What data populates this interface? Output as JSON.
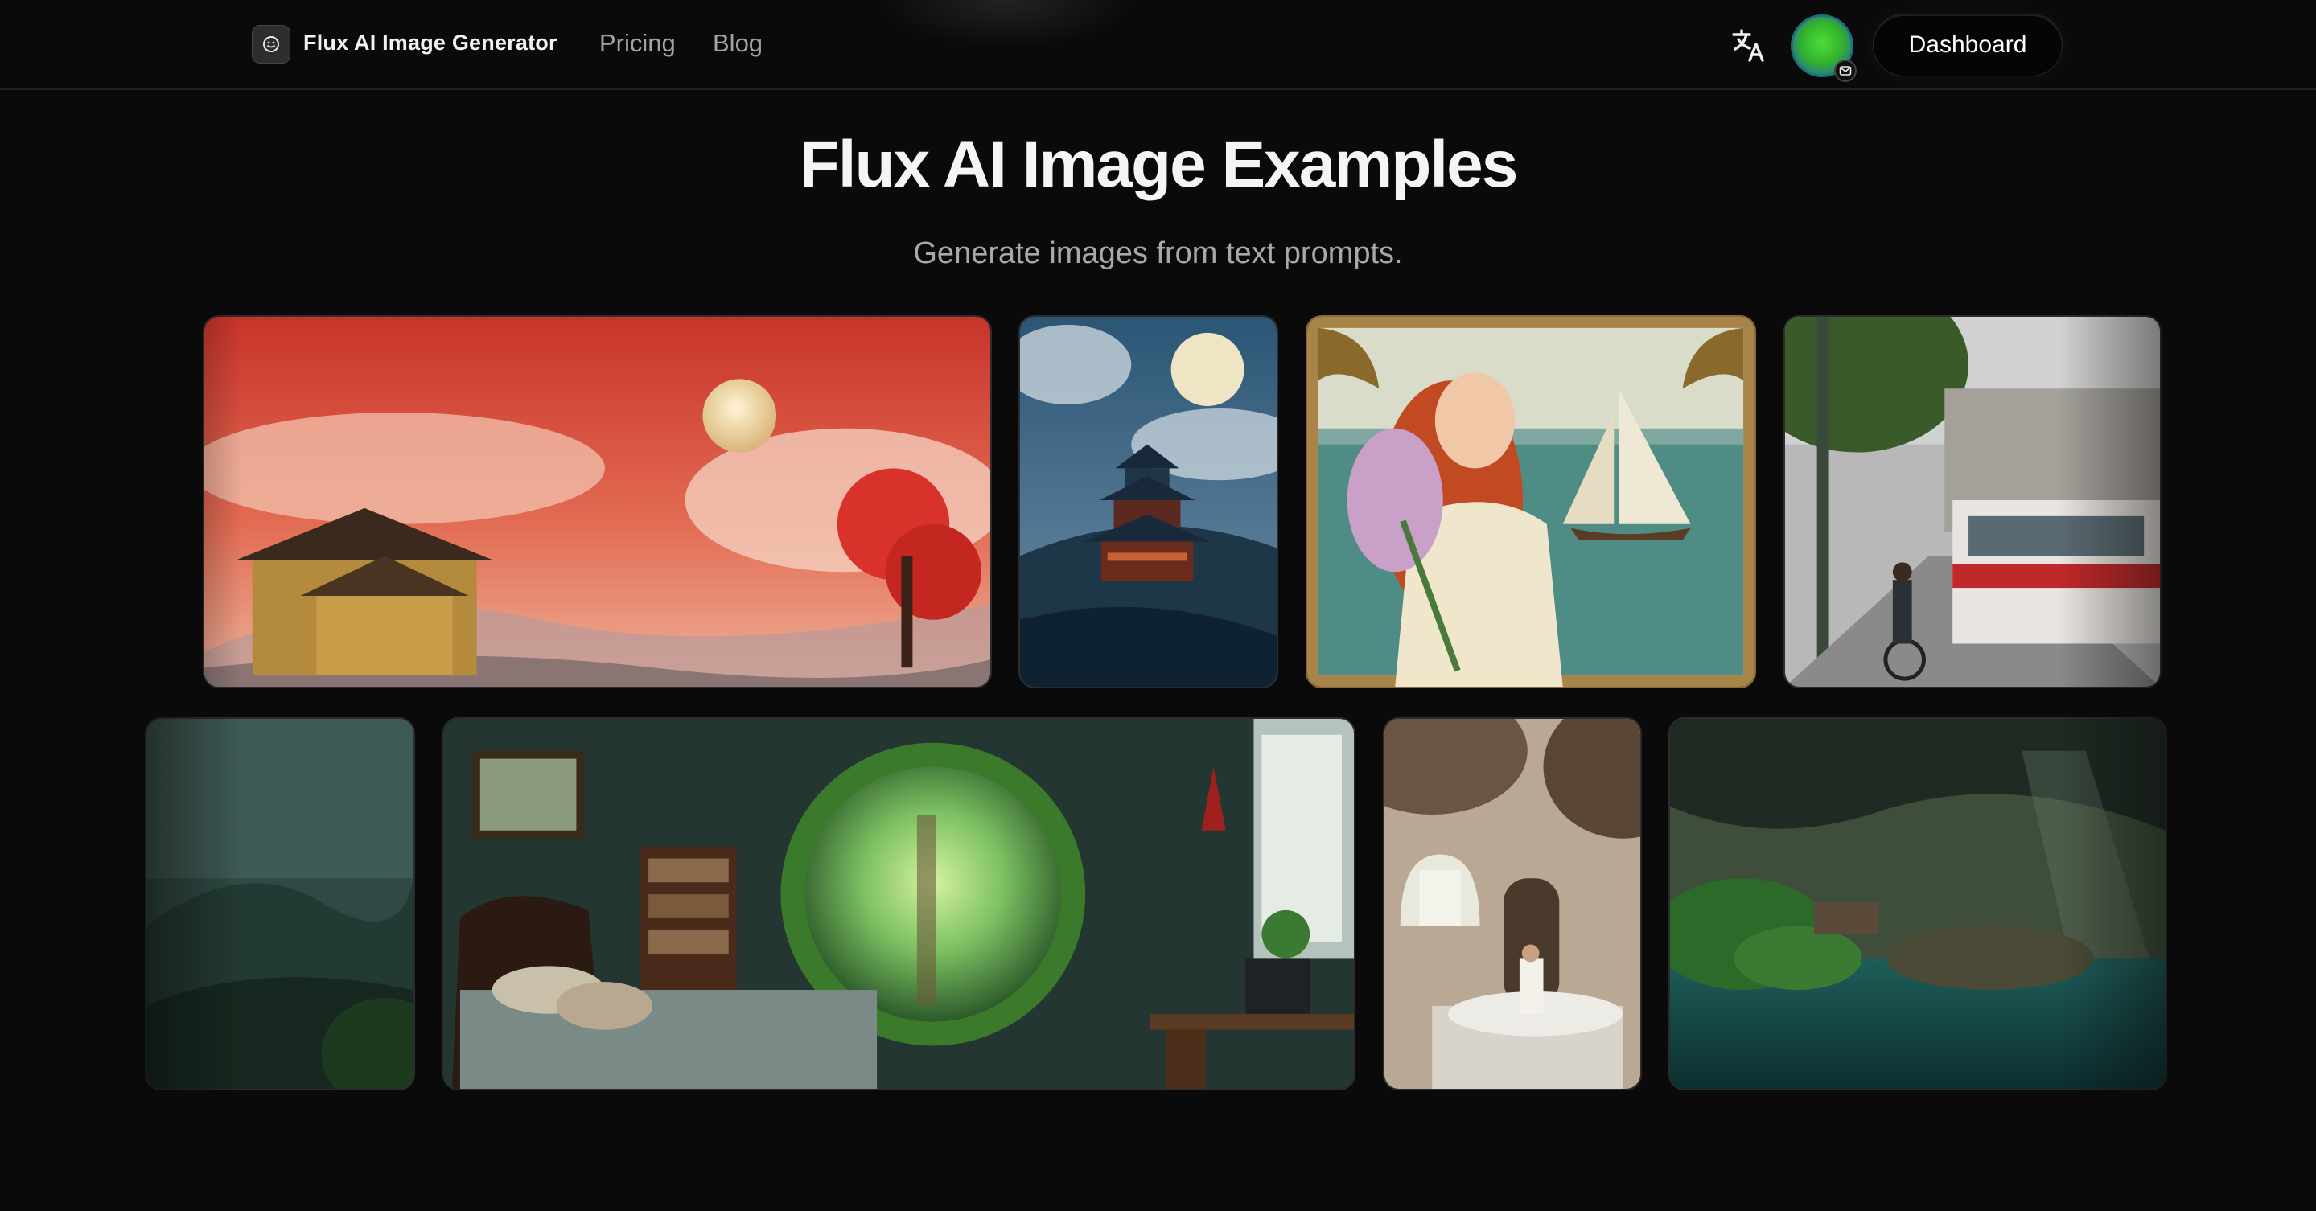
{
  "header": {
    "brand": "Flux AI Image Generator",
    "nav": [
      {
        "label": "Pricing"
      },
      {
        "label": "Blog"
      }
    ],
    "icons": {
      "logo": "sparkle-face-icon",
      "translate": "translate-icon",
      "avatar_badge": "mail-icon"
    },
    "dashboard_label": "Dashboard"
  },
  "hero": {
    "title": "Flux AI Image Examples",
    "subtitle": "Generate images from text prompts."
  },
  "gallery": {
    "row1": [
      {
        "subject": "red-sky-temple-moon"
      },
      {
        "subject": "pagoda-moon-clouds"
      },
      {
        "subject": "art-nouveau-woman-flowers"
      },
      {
        "subject": "city-street-tram"
      }
    ],
    "row2": [
      {
        "subject": "misty-green-mountains"
      },
      {
        "subject": "bedroom-forest-portal"
      },
      {
        "subject": "cave-bedroom"
      },
      {
        "subject": "cave-lagoon"
      }
    ]
  },
  "colors": {
    "background": "#0a0a0a",
    "text": "#f5f5f5",
    "muted": "#a3a3a3"
  }
}
